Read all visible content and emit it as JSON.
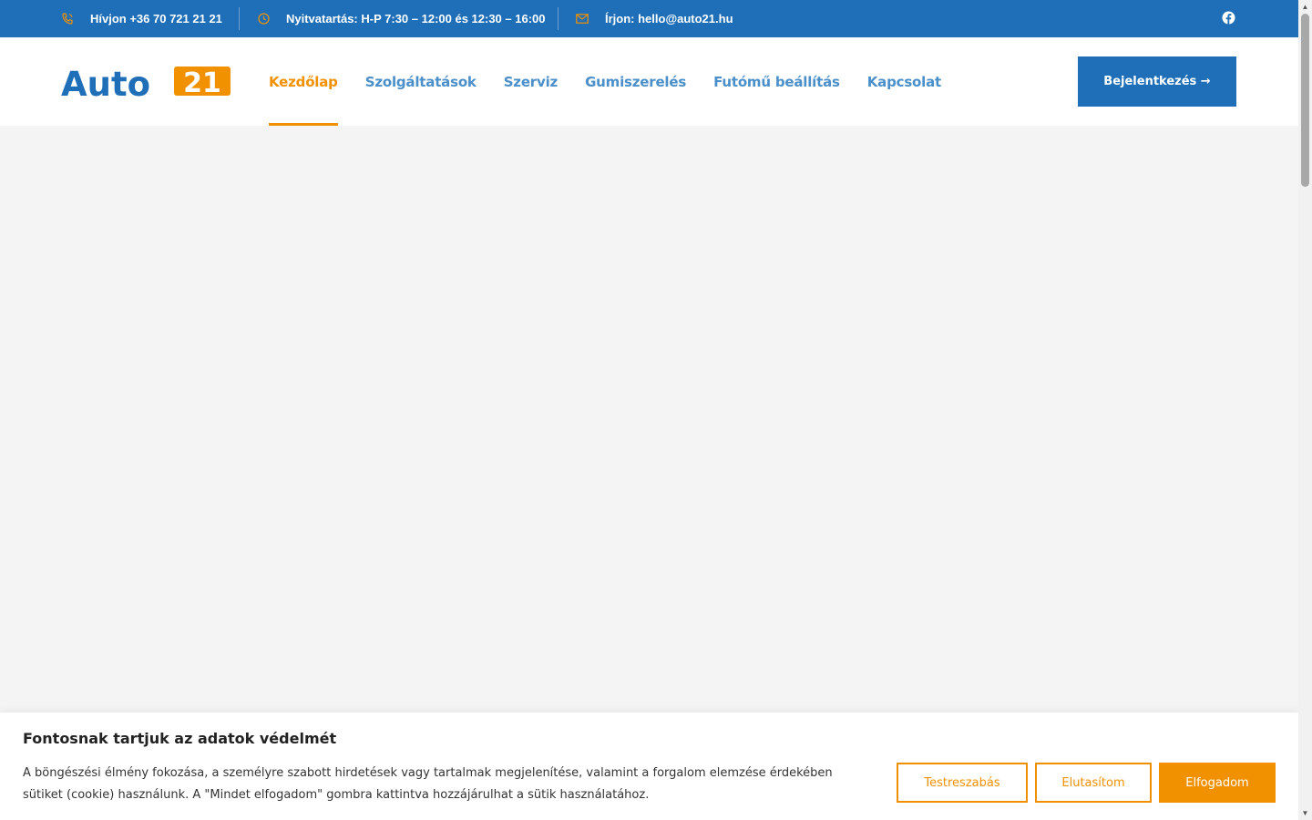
{
  "topbar": {
    "phone": "Hívjon +36 70 721 21 21",
    "hours": "Nyitvatartás: H-P 7:30 – 12:00 és 12:30 – 16:00",
    "email": "Írjon: hello@auto21.hu",
    "icons": [
      "phone-icon",
      "clock-icon",
      "envelope-icon",
      "facebook-icon"
    ]
  },
  "logo": {
    "text_left": "Auto",
    "text_right": "21"
  },
  "nav": {
    "items": [
      {
        "label": "Kezdőlap",
        "active": true
      },
      {
        "label": "Szolgáltatások",
        "active": false
      },
      {
        "label": "Szerviz",
        "active": false
      },
      {
        "label": "Gumiszerelés",
        "active": false
      },
      {
        "label": "Futómű beállítás",
        "active": false
      },
      {
        "label": "Kapcsolat",
        "active": false
      }
    ],
    "login_label": "Bejelentkezés →"
  },
  "cookie": {
    "title": "Fontosnak tartjuk az adatok védelmét",
    "text": "A böngészési élmény fokozása, a személyre szabott hirdetések vagy tartalmak megjelenítése, valamint a forgalom elemzése érdekében sütiket (cookie) használunk. A \"Mindet elfogadom\" gombra kattintva hozzájárulhat a sütik használatához.",
    "customize_label": "Testreszabás",
    "reject_label": "Elutasítom",
    "accept_label": "Elfogadom"
  },
  "colors": {
    "primary_blue": "#1f6fb8",
    "nav_blue": "#4a8fc9",
    "accent_orange": "#f29100",
    "background": "#f4f4f4"
  }
}
